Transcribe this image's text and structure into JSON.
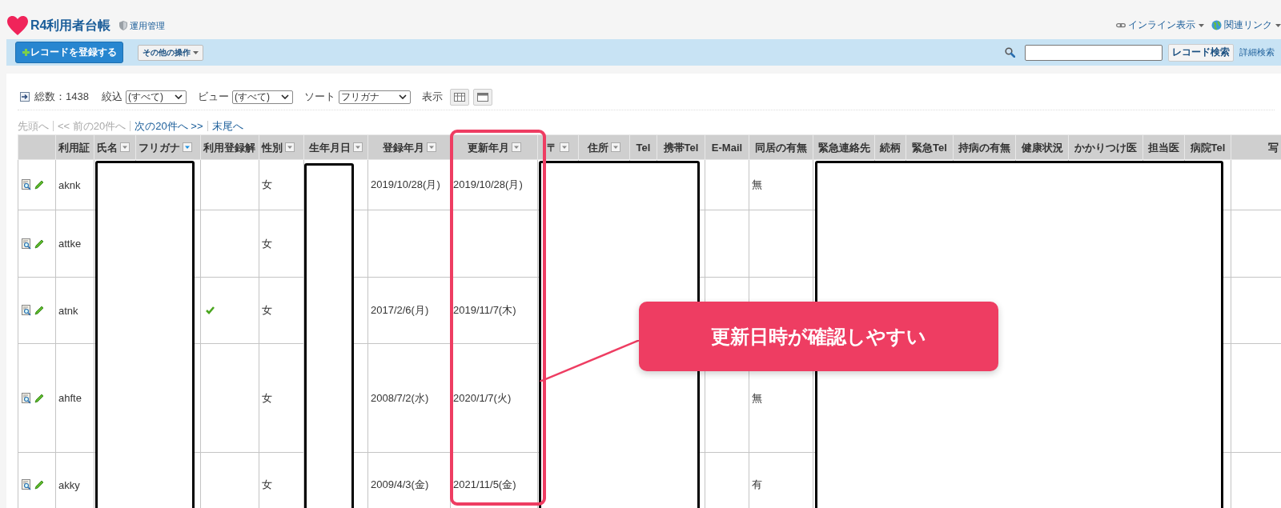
{
  "app": {
    "title": "R4利用者台帳",
    "admin_link": "運用管理",
    "header_links": [
      "インライン表示",
      "関連リンク"
    ]
  },
  "toolbar": {
    "add_button": "レコードを登録する",
    "other_button": "その他の操作",
    "search_button": "レコード検索",
    "advanced_link": "詳細検索"
  },
  "list_bar": {
    "total": "総数：1438",
    "filters": [
      {
        "label": "絞込",
        "value": "(すべて)"
      },
      {
        "label": "ビュー",
        "value": "(すべて)"
      },
      {
        "label": "ソート",
        "value": "フリガナ"
      }
    ],
    "display_label": "表示"
  },
  "pager": [
    {
      "label": "先頭へ",
      "disabled": true
    },
    {
      "label": "<< 前の20件へ",
      "disabled": true
    },
    {
      "label": "次の20件へ >>",
      "disabled": false
    },
    {
      "label": "末尾へ",
      "disabled": false
    }
  ],
  "table": {
    "columns": [
      {
        "has_filter": false
      },
      {
        "label": "利用証",
        "has_filter": false
      },
      {
        "label": "氏名",
        "has_filter": true,
        "filter_active": false
      },
      {
        "label": "フリガナ",
        "has_filter": true,
        "filter_active": true
      },
      {
        "label": "利用登録解",
        "has_filter": false
      },
      {
        "label": "性別",
        "has_filter": true,
        "filter_active": false
      },
      {
        "label": "生年月日",
        "has_filter": true,
        "filter_active": false
      },
      {
        "label": "登録年月",
        "has_filter": true,
        "filter_active": false
      },
      {
        "label": "更新年月",
        "has_filter": true,
        "filter_active": false
      },
      {
        "label": "〒",
        "has_filter": true,
        "filter_active": false
      },
      {
        "label": "住所",
        "has_filter": true,
        "filter_active": false
      },
      {
        "label": "Tel",
        "has_filter": false
      },
      {
        "label": "携帯Tel",
        "has_filter": false
      },
      {
        "label": "E-Mail",
        "has_filter": false
      },
      {
        "label": "同居の有無",
        "has_filter": false
      },
      {
        "label": "緊急連絡先",
        "has_filter": false
      },
      {
        "label": "続柄",
        "has_filter": false
      },
      {
        "label": "緊急Tel",
        "has_filter": false
      },
      {
        "label": "持病の有無",
        "has_filter": false
      },
      {
        "label": "健康状況",
        "has_filter": false
      },
      {
        "label": "かかりつけ医",
        "has_filter": false
      },
      {
        "label": "担当医",
        "has_filter": false
      },
      {
        "label": "病院Tel",
        "has_filter": false
      },
      {
        "label": "写",
        "has_filter": false
      }
    ],
    "rows": [
      {
        "user_id": "aknk",
        "cancelled": false,
        "gender": "女",
        "registered_on": "2019/10/28(月)",
        "updated_on": "2019/10/28(月)",
        "cohabitation": "無"
      },
      {
        "user_id": "attke",
        "cancelled": false,
        "gender": "女"
      },
      {
        "user_id": "atnk",
        "cancelled": true,
        "gender": "女",
        "registered_on": "2017/2/6(月)",
        "updated_on": "2019/11/7(木)"
      },
      {
        "user_id": "ahfte",
        "cancelled": false,
        "gender": "女",
        "registered_on": "2008/7/2(水)",
        "updated_on": "2020/1/7(火)",
        "cohabitation": "無"
      },
      {
        "user_id": "akky",
        "cancelled": false,
        "gender": "女",
        "registered_on": "2009/4/3(金)",
        "updated_on": "2021/11/5(金)",
        "cohabitation": "有"
      }
    ]
  },
  "callout": {
    "text": "更新日時が確認しやすい"
  }
}
